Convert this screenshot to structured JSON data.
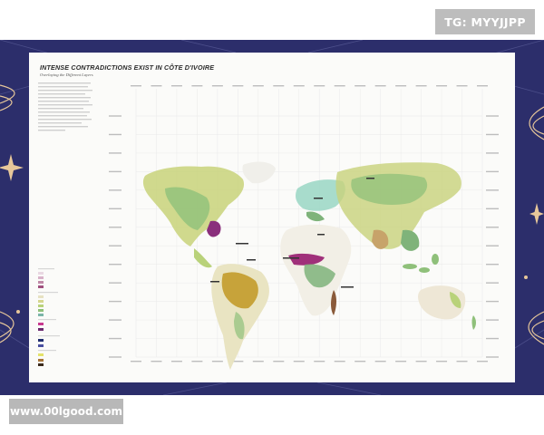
{
  "watermarks": {
    "top_right": "TG: MYYJJPP",
    "bottom_left": "www.00lgood.com"
  },
  "poster": {
    "title": "INTENSE CONTRADICTIONS EXIST IN CÔTE D'IVOIRE",
    "subtitle": "Overlaying the Different Layers"
  },
  "map": {
    "type": "world-map",
    "graticule": true,
    "top_tick_count": 18,
    "left_tick_count": 14,
    "colors": {
      "frame": "#2c2e6b",
      "frame_ornament": "#e7c79a",
      "paper": "#fbfbf9",
      "forest_green": "#7fb37a",
      "yellow_green": "#c8cf6a",
      "mint": "#9fd8c6",
      "magenta": "#a0307a",
      "tan": "#c7a36a"
    }
  }
}
